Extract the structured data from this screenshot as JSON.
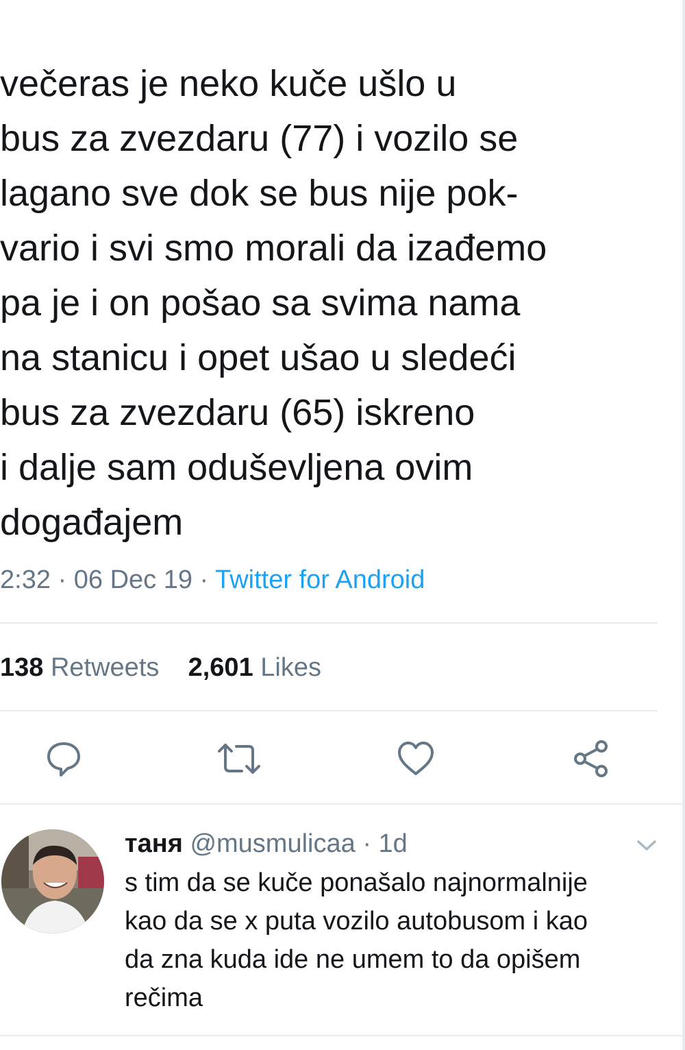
{
  "tweet": {
    "text_lines": [
      "večeras je neko kuče ušlo u",
      "bus za zvezdaru (77) i vozilo se",
      "lagano sve dok se bus nije pok-",
      "vario i svi smo morali da izađemo",
      "pa je i on pošao sa svima nama",
      "na stanicu i opet ušao u sledeći",
      "bus za zvezdaru (65) iskreno",
      "i dalje sam oduševljena ovim",
      "događajem"
    ],
    "time": "2:32",
    "date": "06 Dec 19",
    "separator": "·",
    "source": "Twitter for Android",
    "retweets_count": "138",
    "retweets_label": "Retweets",
    "likes_count": "2,601",
    "likes_label": "Likes"
  },
  "actions": {
    "reply_icon": "speech-bubble-icon",
    "retweet_icon": "retweet-icon",
    "like_icon": "heart-icon",
    "share_icon": "share-icon"
  },
  "reply": {
    "name": "таня",
    "handle": "@musmulicaa",
    "separator": "·",
    "age": "1d",
    "text_lines": [
      "s tim da se kuče ponašalo najnormalnije",
      "kao da se x puta vozilo autobusom i kao",
      "da zna kuda ide ne umem to da opišem",
      "rečima"
    ]
  },
  "colors": {
    "text": "#14171a",
    "secondary": "#657786",
    "link": "#1da1f2",
    "divider": "#e6ecf0"
  }
}
